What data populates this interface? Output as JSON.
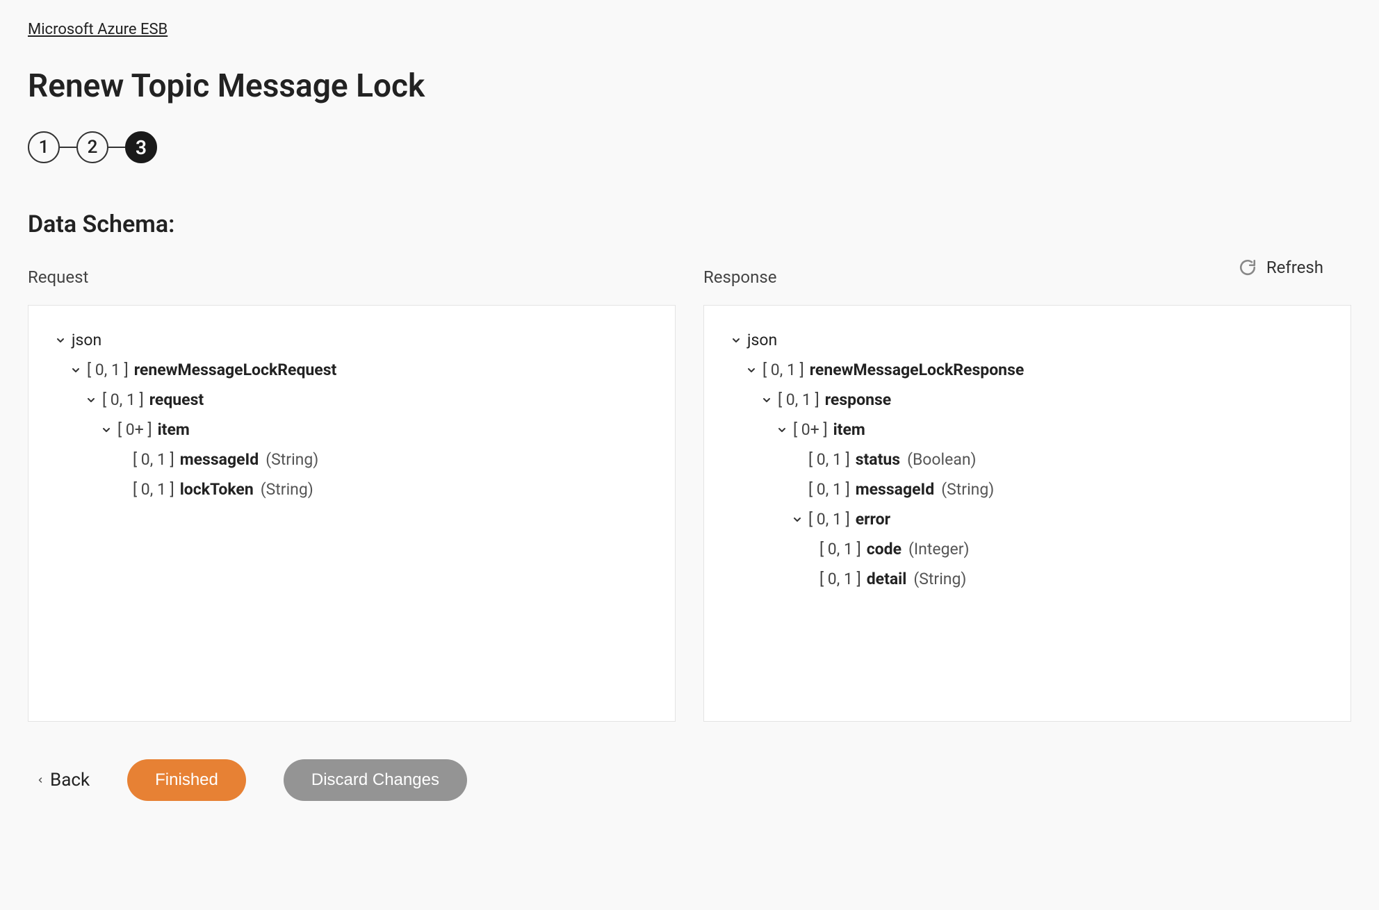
{
  "breadcrumb": "Microsoft Azure ESB",
  "page_title": "Renew Topic Message Lock",
  "stepper": {
    "steps": [
      "1",
      "2",
      "3"
    ],
    "active_index": 2
  },
  "section_title": "Data Schema:",
  "refresh_label": "Refresh",
  "panels": {
    "request": {
      "label": "Request",
      "root": "json",
      "tree": [
        {
          "cardinality": "[ 0, 1 ]",
          "name": "renewMessageLockRequest"
        },
        {
          "cardinality": "[ 0, 1 ]",
          "name": "request"
        },
        {
          "cardinality": "[ 0+ ]",
          "name": "item"
        },
        {
          "cardinality": "[ 0, 1 ]",
          "name": "messageId",
          "type": "(String)"
        },
        {
          "cardinality": "[ 0, 1 ]",
          "name": "lockToken",
          "type": "(String)"
        }
      ]
    },
    "response": {
      "label": "Response",
      "root": "json",
      "tree": [
        {
          "cardinality": "[ 0, 1 ]",
          "name": "renewMessageLockResponse"
        },
        {
          "cardinality": "[ 0, 1 ]",
          "name": "response"
        },
        {
          "cardinality": "[ 0+ ]",
          "name": "item"
        },
        {
          "cardinality": "[ 0, 1 ]",
          "name": "status",
          "type": "(Boolean)"
        },
        {
          "cardinality": "[ 0, 1 ]",
          "name": "messageId",
          "type": "(String)"
        },
        {
          "cardinality": "[ 0, 1 ]",
          "name": "error"
        },
        {
          "cardinality": "[ 0, 1 ]",
          "name": "code",
          "type": "(Integer)"
        },
        {
          "cardinality": "[ 0, 1 ]",
          "name": "detail",
          "type": "(String)"
        }
      ]
    }
  },
  "footer": {
    "back": "Back",
    "finished": "Finished",
    "discard": "Discard Changes"
  }
}
